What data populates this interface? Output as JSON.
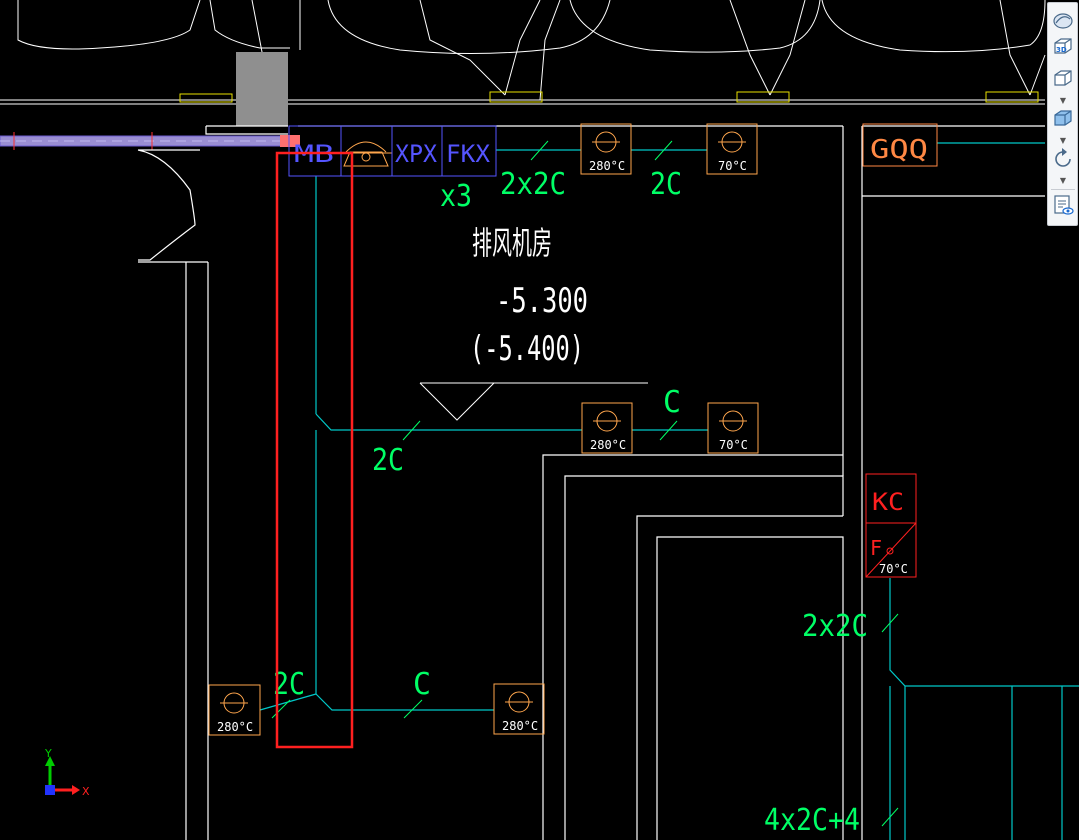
{
  "room": {
    "name": "排风机房",
    "elevation": "-5.300",
    "elevation_alt": "(-5.400)"
  },
  "equipment": {
    "mb": "MB",
    "xpx": "XPX",
    "fkx": "FKX",
    "gqq": "GQQ",
    "kc": "KC",
    "f_mark": "F"
  },
  "wire_labels": {
    "x3": "x3",
    "top_2x2c": "2x2C",
    "top_2c": "2C",
    "mid_c": "C",
    "mid_2c": "2C",
    "bottom_2c": "2C",
    "bottom_c": "C",
    "right_2x2c": "2x2C",
    "right_4x2c4": "4x2C+4"
  },
  "dampers": {
    "top_280": "280°C",
    "top_70": "70°C",
    "mid_280": "280°C",
    "mid_70": "70°C",
    "left_280": "280°C",
    "bottom_280": "280°C",
    "kc_70": "70°C"
  },
  "axes": {
    "y": "Y",
    "x": "X"
  },
  "toolbar": {
    "view_3d_label": "3D"
  },
  "colors": {
    "background": "#000000",
    "wall": "#ffffff",
    "cable": "#00c8c8",
    "wire_text": "#00ff00",
    "equipment_box": "#5555ff",
    "damper": "#ffa64d",
    "alarm": "#ff2020",
    "selection": "#ff2020"
  }
}
